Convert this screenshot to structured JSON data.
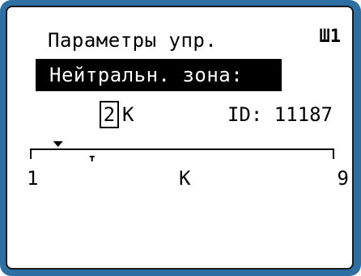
{
  "screen": {
    "title": "Параметры упр.",
    "channel_indicator": "Ш1",
    "selected_item": "Нейтральн. зона:",
    "value": "2",
    "unit": "K",
    "id_label": "ID: 11187"
  },
  "scale": {
    "min_label": "1",
    "unit_label": "K",
    "max_label": "9",
    "marker_value": 2,
    "min": 1,
    "max": 9
  },
  "colors": {
    "frame": "#2e6fa3",
    "screen_background": "#ffffff",
    "text": "#000000",
    "highlight_background": "#000000",
    "highlight_text": "#ffffff"
  }
}
